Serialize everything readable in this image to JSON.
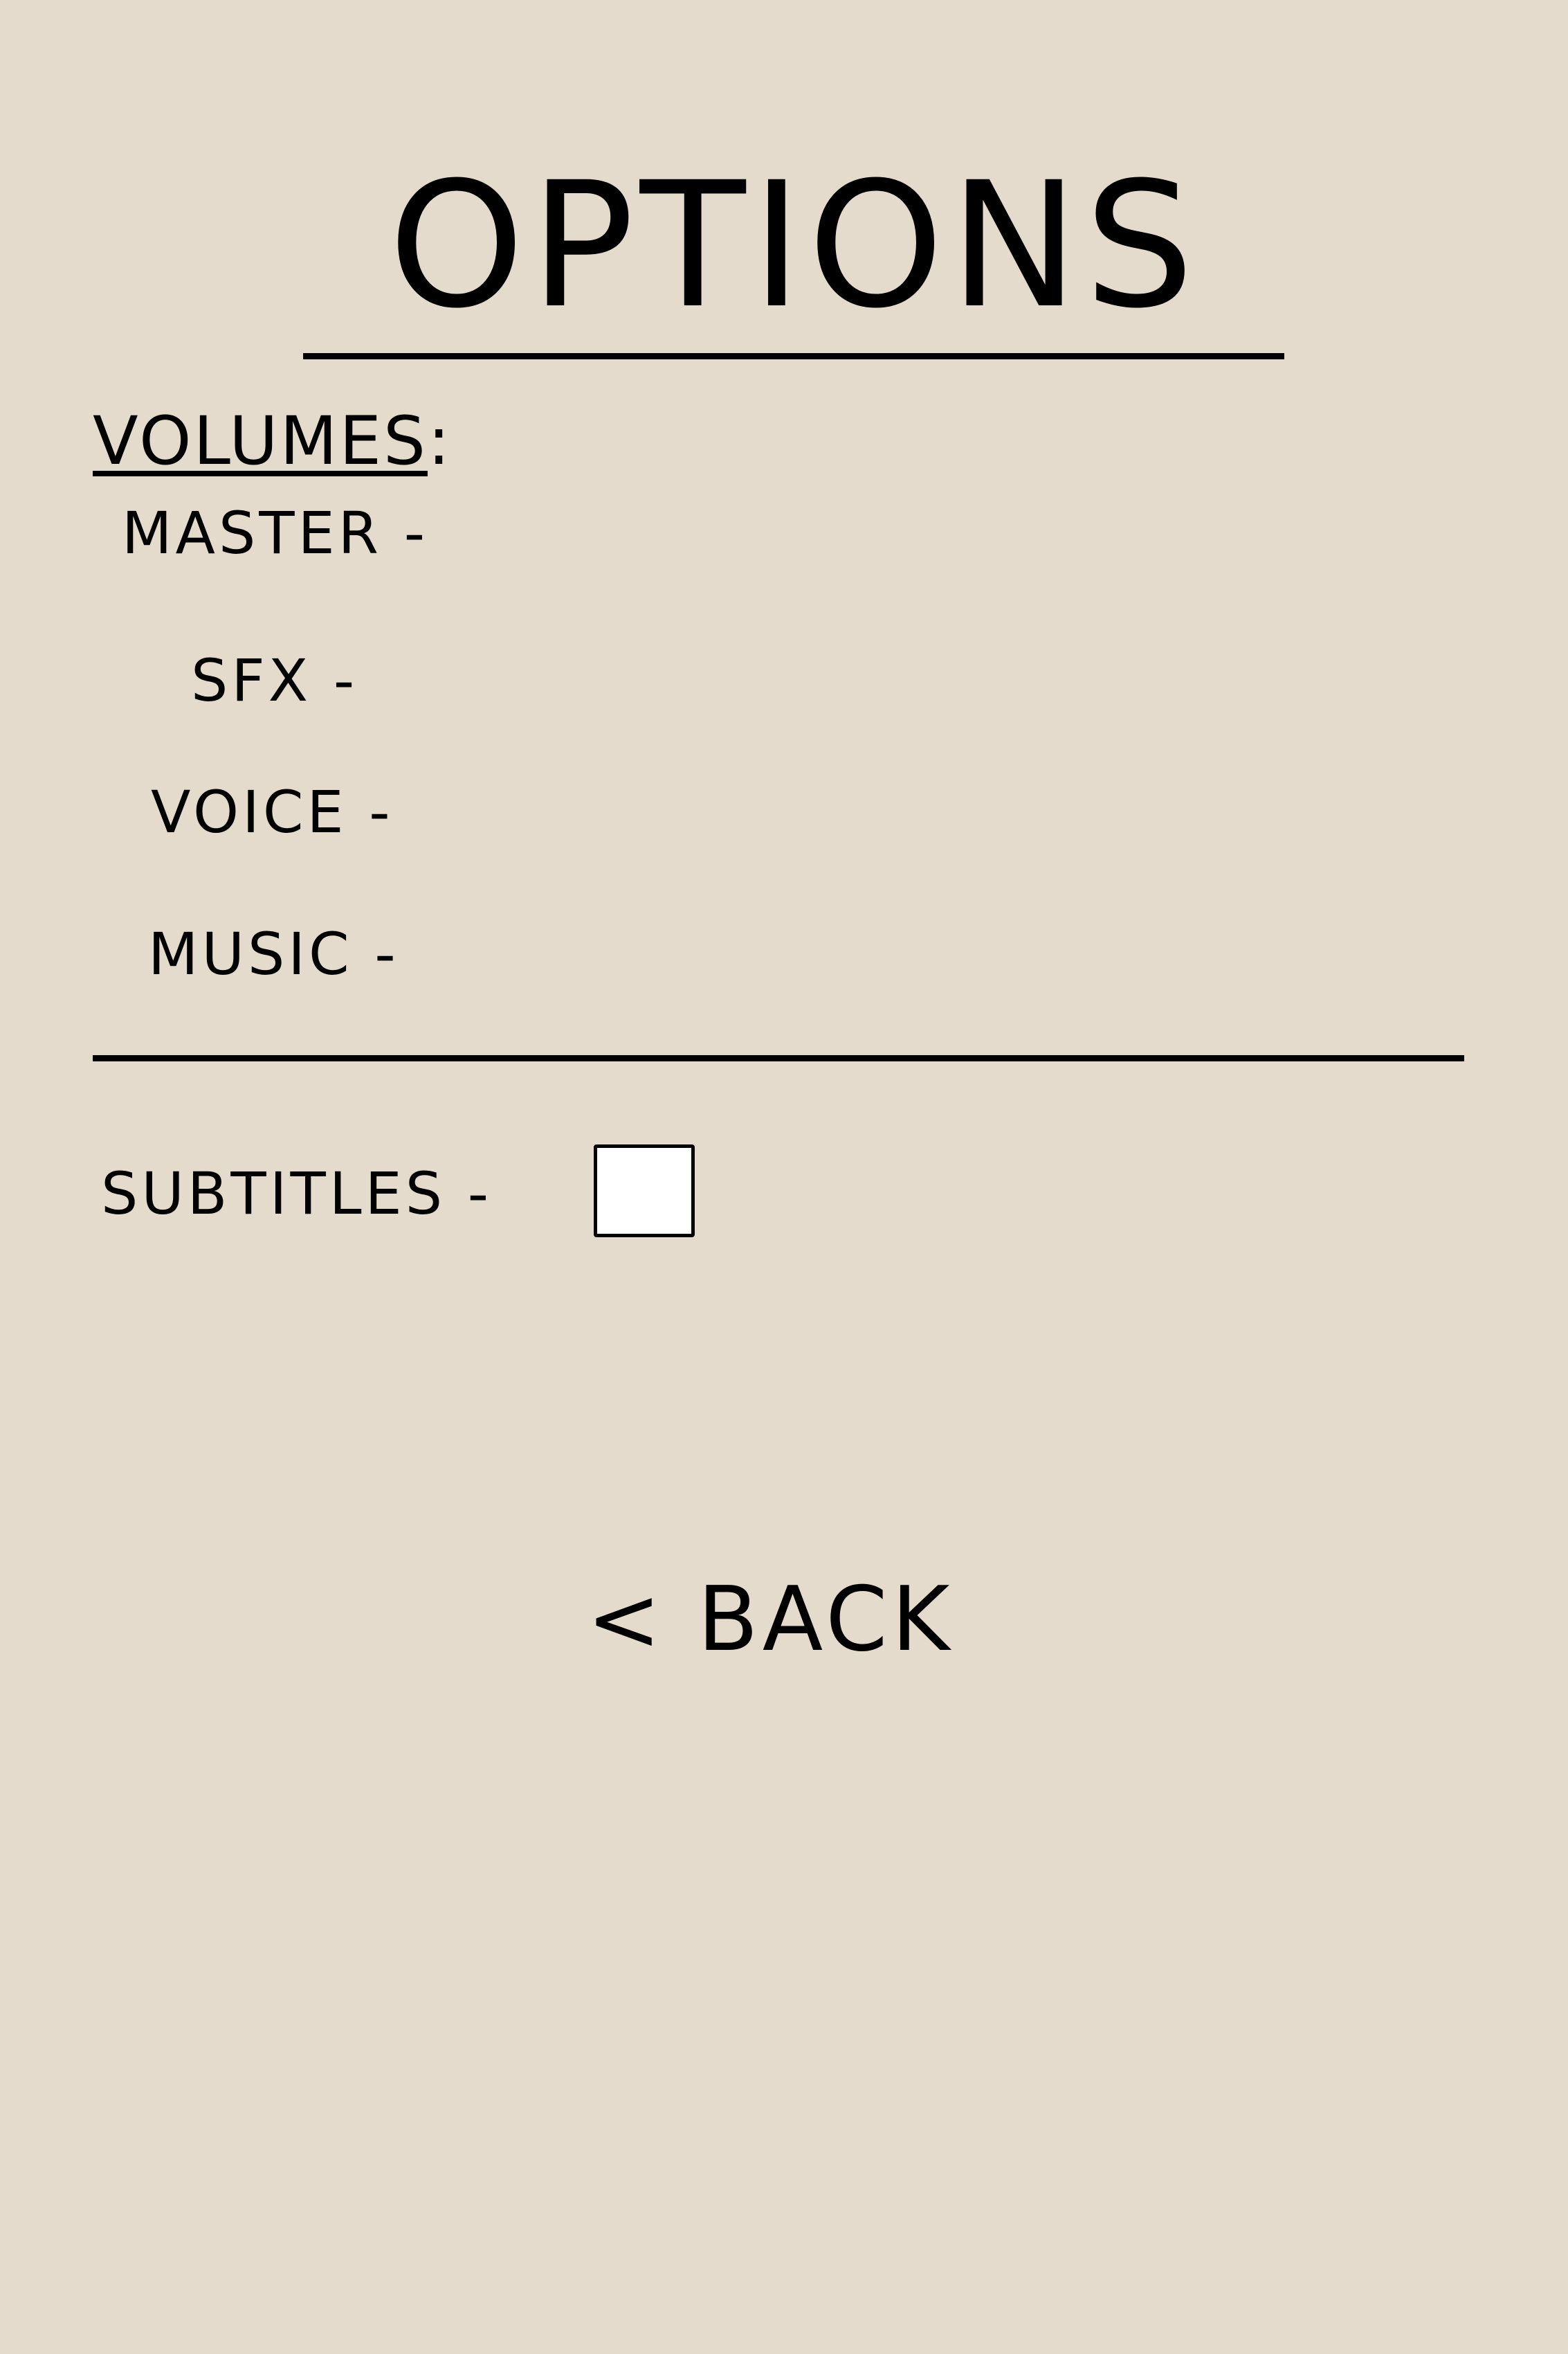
{
  "screen": {
    "title": "OPTIONS",
    "background_color": "#e4dbcd"
  },
  "volumes": {
    "heading": "VOLUMES",
    "heading_suffix": ":",
    "items": [
      {
        "label": "MASTER -"
      },
      {
        "label": "SFX -"
      },
      {
        "label": "VOICE -"
      },
      {
        "label": "MUSIC -"
      }
    ]
  },
  "subtitles": {
    "label": "SUBTITLES -",
    "checked": false
  },
  "back": {
    "label": "< BACK"
  }
}
